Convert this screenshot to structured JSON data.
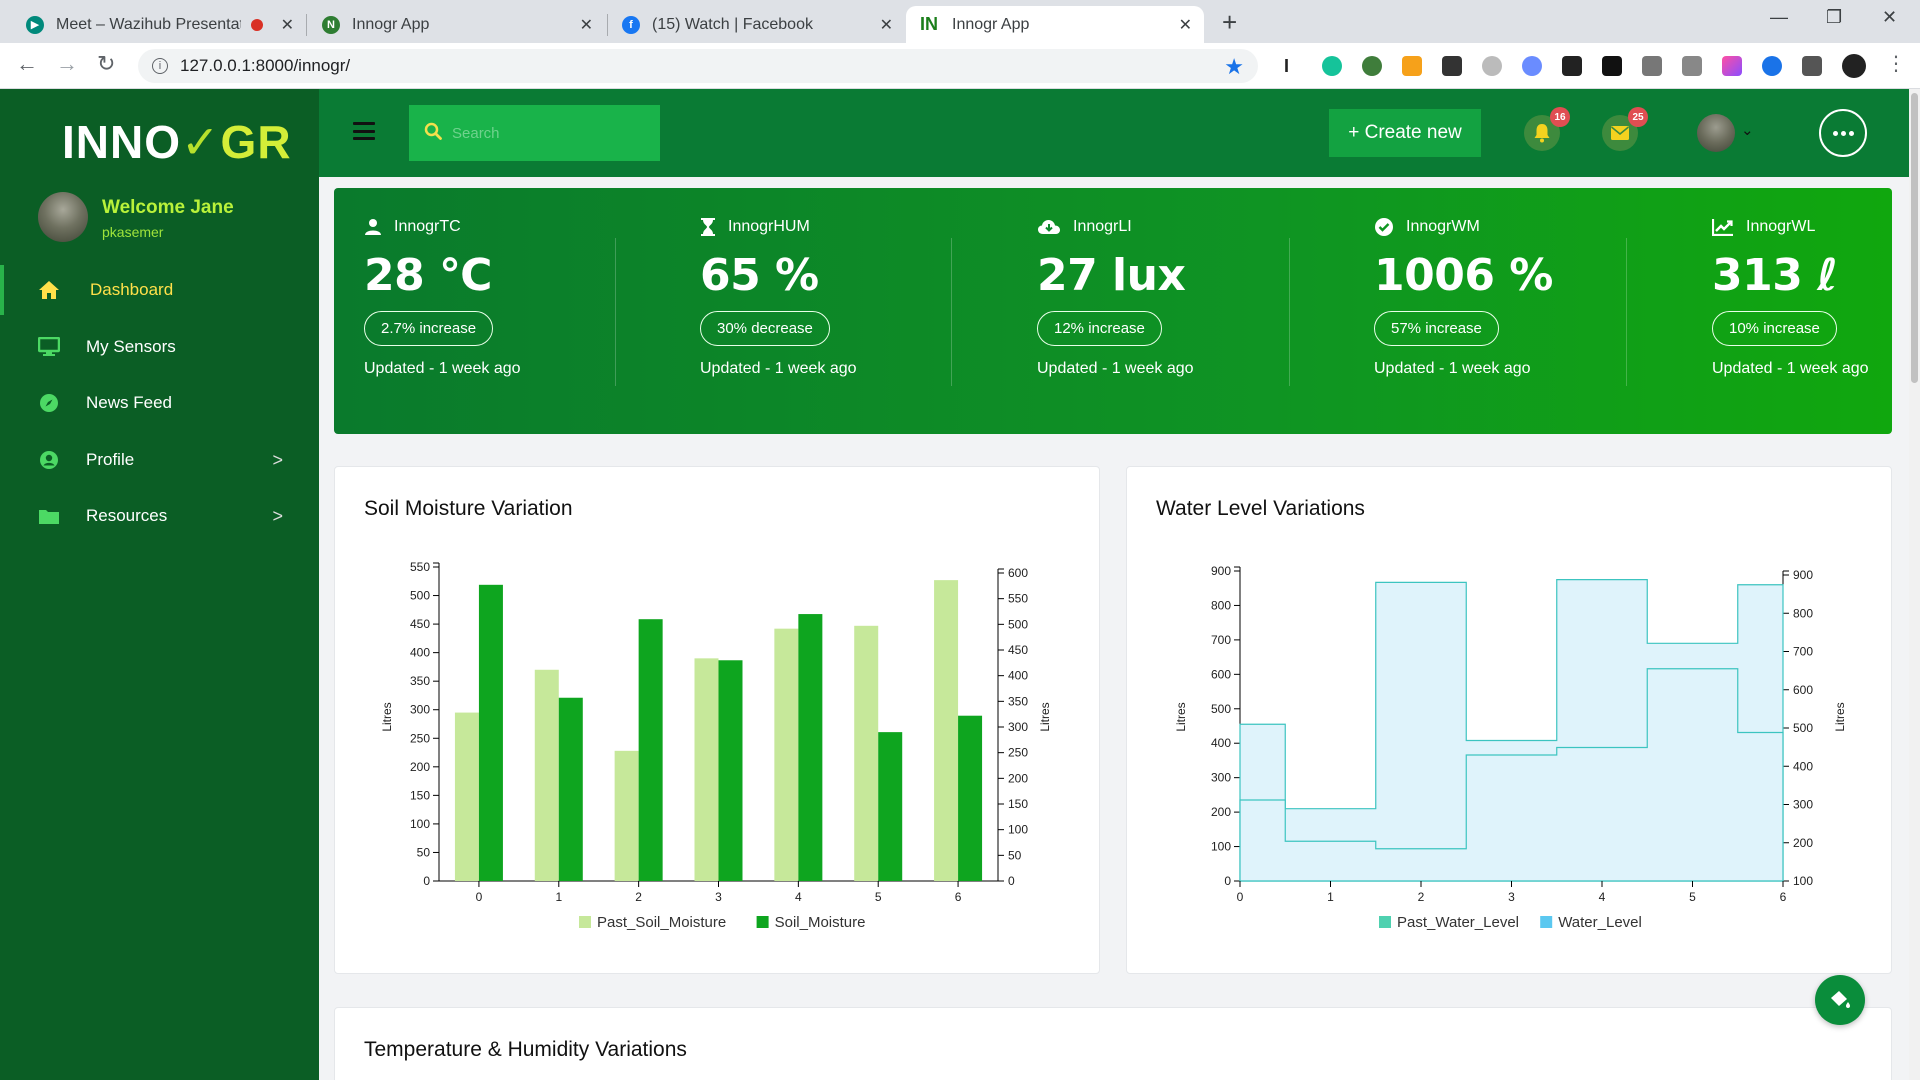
{
  "browser": {
    "tabs": [
      {
        "title": "Meet – Wazihub Presentatio",
        "favicon": "google-meet-icon",
        "recording": true
      },
      {
        "title": "Innogr App",
        "favicon": "innogr-icon"
      },
      {
        "title": "(15) Watch | Facebook",
        "favicon": "facebook-icon"
      },
      {
        "title": "Innogr App",
        "favicon": "innogr-in-icon",
        "active": true
      }
    ],
    "url": "127.0.0.1:8000/innogr/"
  },
  "sidebar": {
    "logo_left": "INNO",
    "logo_right": "GR",
    "welcome": "Welcome Jane",
    "username": "pkasemer",
    "items": [
      {
        "label": "Dashboard",
        "icon": "home-icon",
        "active": true
      },
      {
        "label": "My Sensors",
        "icon": "monitor-icon"
      },
      {
        "label": "News Feed",
        "icon": "compass-icon"
      },
      {
        "label": "Profile",
        "icon": "user-circle-icon",
        "expandable": true
      },
      {
        "label": "Resources",
        "icon": "folder-icon",
        "expandable": true
      }
    ]
  },
  "header": {
    "search_placeholder": "Search",
    "create_label": "+ Create new",
    "notifications_count": "16",
    "messages_count": "25"
  },
  "stats": [
    {
      "title": "InnogrTC",
      "icon": "user-icon",
      "value": "28 ℃",
      "change": "2.7% increase",
      "updated": "Updated - 1 week ago"
    },
    {
      "title": "InnogrHUM",
      "icon": "hourglass-icon",
      "value": "65 %",
      "change": "30% decrease",
      "updated": "Updated - 1 week ago"
    },
    {
      "title": "InnogrLI",
      "icon": "cloud-download-icon",
      "value": "27 lux",
      "change": "12% increase",
      "updated": "Updated - 1 week ago"
    },
    {
      "title": "InnogrWM",
      "icon": "check-circle-icon",
      "value": "1006 %",
      "change": "57% increase",
      "updated": "Updated - 1 week ago"
    },
    {
      "title": "InnogrWL",
      "icon": "line-chart-icon",
      "value": "313 ℓ",
      "change": "10% increase",
      "updated": "Updated - 1 week ago"
    }
  ],
  "cards": {
    "soil_title": "Soil Moisture Variation",
    "water_title": "Water Level Variations",
    "temp_title": "Temperature & Humidity Variations"
  },
  "colors": {
    "past_soil": "#c6e89a",
    "soil": "#0ea51f",
    "past_water": "#4fd1b0",
    "water": "#5bc8f0"
  },
  "chart_data": [
    {
      "type": "bar",
      "title": "Soil Moisture Variation",
      "categories": [
        "0",
        "1",
        "2",
        "3",
        "4",
        "5",
        "6"
      ],
      "ylabel": "Litres",
      "y2label": "Litres",
      "ylim": [
        0,
        550
      ],
      "y2lim": [
        0,
        600
      ],
      "yticks": [
        0,
        50,
        100,
        150,
        200,
        250,
        300,
        350,
        400,
        450,
        500,
        550
      ],
      "y2ticks": [
        0,
        50,
        100,
        150,
        200,
        250,
        300,
        350,
        400,
        450,
        500,
        550,
        600
      ],
      "legend": "bottom",
      "series": [
        {
          "name": "Past_Soil_Moisture",
          "axis": "left",
          "values": [
            295,
            370,
            228,
            390,
            442,
            447,
            527
          ]
        },
        {
          "name": "Soil_Moisture",
          "axis": "right",
          "values": [
            577,
            357,
            510,
            430,
            520,
            290,
            322
          ]
        }
      ]
    },
    {
      "type": "area",
      "step": true,
      "title": "Water Level Variations",
      "x": [
        0,
        1,
        2,
        3,
        4,
        5,
        6
      ],
      "ylabel": "Litres",
      "y2label": "Litres",
      "ylim": [
        0,
        900
      ],
      "y2lim": [
        100,
        900
      ],
      "yticks": [
        0,
        100,
        200,
        300,
        400,
        500,
        600,
        700,
        800,
        900
      ],
      "y2ticks": [
        100,
        200,
        300,
        400,
        500,
        600,
        700,
        800,
        900
      ],
      "legend": "bottom",
      "series": [
        {
          "name": "Past_Water_Level",
          "axis": "left",
          "values": [
            455,
            210,
            867,
            408,
            875,
            690,
            860
          ]
        },
        {
          "name": "Water_Level",
          "axis": "right",
          "values": [
            300,
            190,
            170,
            420,
            440,
            650,
            480
          ]
        }
      ]
    }
  ]
}
